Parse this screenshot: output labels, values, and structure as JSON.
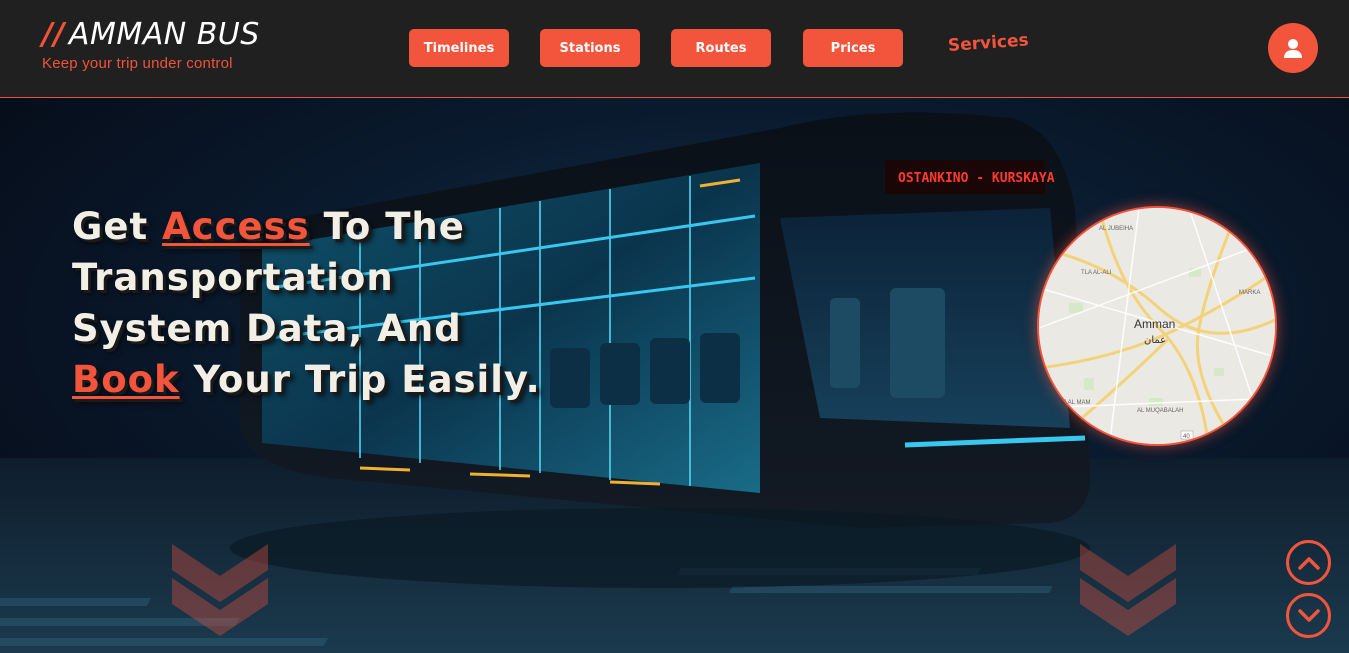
{
  "header": {
    "logo_slash": "//",
    "logo_title": "AMMAN BUS",
    "logo_tagline": "Keep your trip under control",
    "nav": [
      {
        "label": "Timelines"
      },
      {
        "label": "Stations"
      },
      {
        "label": "Routes"
      },
      {
        "label": "Prices"
      }
    ],
    "services_label": "Services",
    "user_icon": "user-icon"
  },
  "hero": {
    "headline": {
      "part1": "Get ",
      "highlight1": "Access",
      "part2": " To The Transportation System Data, And ",
      "highlight2": "Book",
      "part3": " Your Trip Easily."
    },
    "bus_sign": "OSTANKINO - KURSKAYA",
    "map": {
      "city": "Amman",
      "city_ar": "عمان",
      "labels": [
        "AL JUBEIHA",
        "TLA AL-ALI",
        "MARKA",
        "AL MUQABALAH",
        "RJ AL MAM"
      ],
      "road_number": "40"
    },
    "scroll_up_icon": "chevron-up-icon",
    "scroll_down_icon": "chevron-down-icon"
  },
  "colors": {
    "accent": "#f2553c",
    "header_bg": "#202020",
    "headline_text": "#f1efe6"
  }
}
